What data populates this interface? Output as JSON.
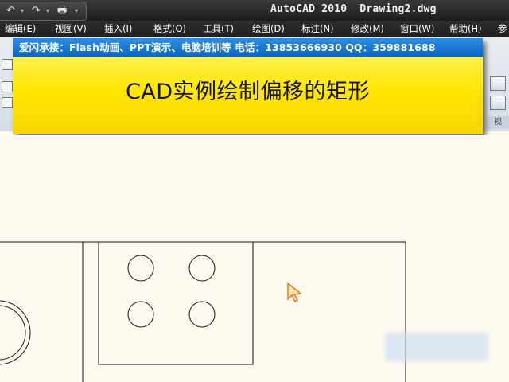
{
  "titlebar": {
    "app_title": "AutoCAD 2010  Drawing2.dwg",
    "quick_access": {
      "undo_icon": "↶",
      "redo_icon": "↷",
      "dropdown_icon": "▾",
      "print_icon": "🖶"
    }
  },
  "menu": {
    "items": [
      "编辑(E)",
      "视图(V)",
      "插入(I)",
      "格式(O)",
      "工具(T)",
      "绘图(D)",
      "标注(N)",
      "修改(M)",
      "窗口(W)",
      "帮助(H)",
      "参"
    ]
  },
  "ribbon": {
    "left_label": "",
    "right_label": "视"
  },
  "banner": {
    "contact_line": "爱闪承接：Flash动画、PPT演示、电脑培训等  电话：13853666930  QQ：359881688",
    "title": "CAD实例绘制偏移的矩形"
  },
  "colors": {
    "banner_blue": "#1479d6",
    "banner_yellow": "#ffe600",
    "canvas_background": "#fdfbef",
    "cursor_orange": "#e07a1c"
  }
}
